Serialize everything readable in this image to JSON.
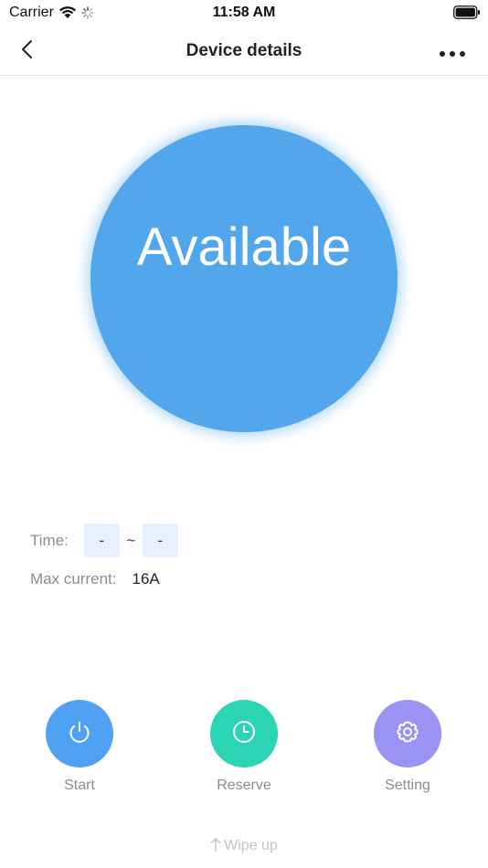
{
  "status_bar": {
    "carrier": "Carrier",
    "time": "11:58 AM"
  },
  "nav": {
    "title": "Device details"
  },
  "device": {
    "status": "Available",
    "status_color": "#52a6ec"
  },
  "info": {
    "time_label": "Time:",
    "time_start": "-",
    "time_separator": "~",
    "time_end": "-",
    "max_current_label": "Max current:",
    "max_current_value": "16A"
  },
  "actions": [
    {
      "label": "Start",
      "icon": "power-icon",
      "color": "#4ea1f3"
    },
    {
      "label": "Reserve",
      "icon": "clock-icon",
      "color": "#2bd4b2"
    },
    {
      "label": "Setting",
      "icon": "gear-icon",
      "color": "#9a93f3"
    }
  ],
  "hint": {
    "wipe_up": "Wipe up"
  }
}
